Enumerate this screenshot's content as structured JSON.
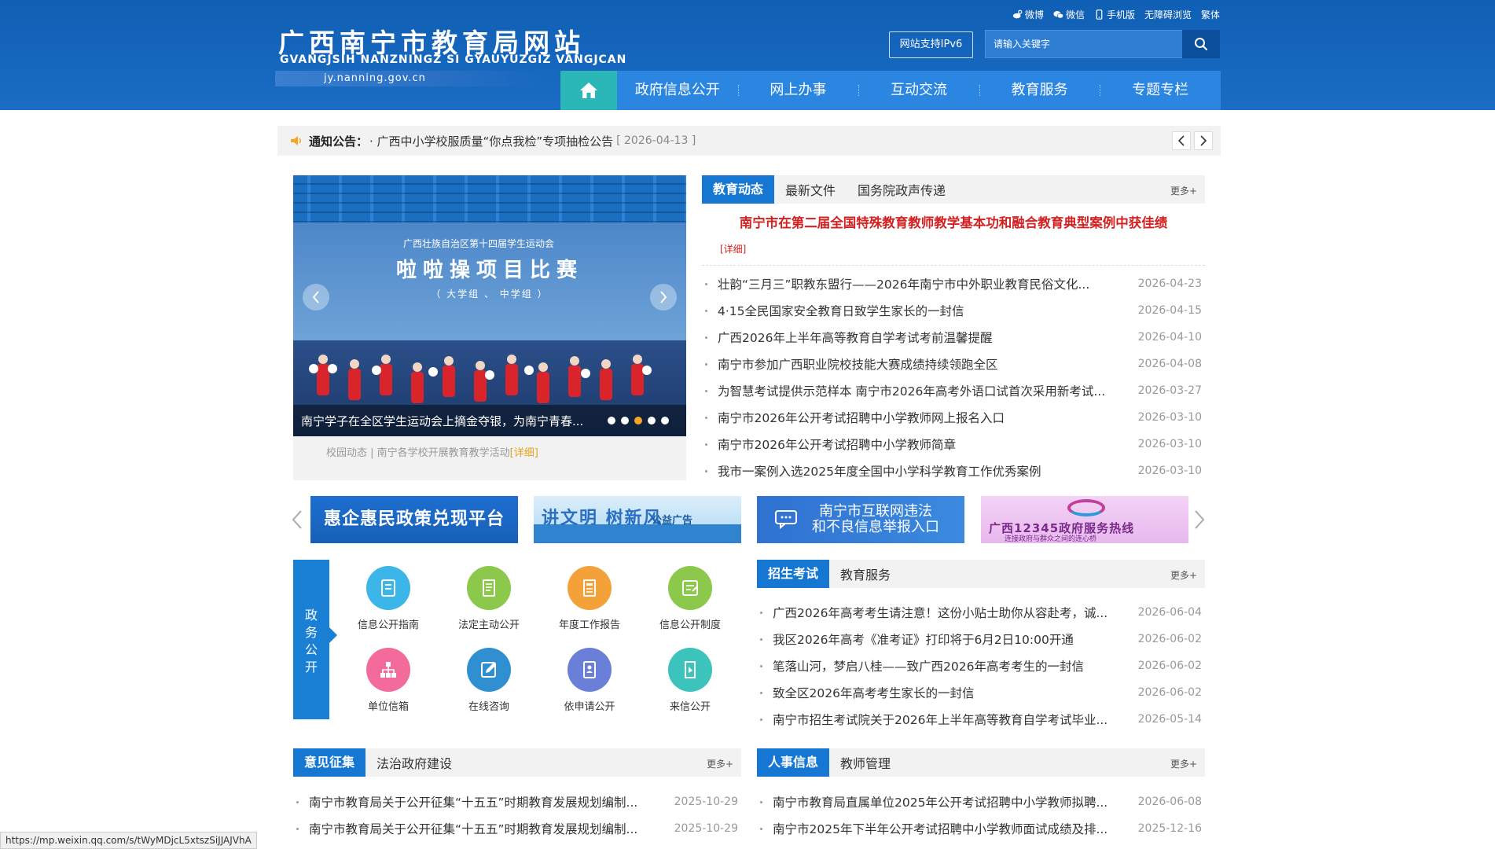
{
  "header": {
    "site_title": "广西南宁市教育局网站",
    "site_pinyin": "GVANGJSIH NANZNINGZ SI GYAUYUZGIZ VANGJCAN",
    "site_url": "jy.nanning.gov.cn",
    "top_links": {
      "weibo": "微博",
      "wechat": "微信",
      "mobile": "手机版",
      "accessibility": "无障碍浏览",
      "traditional": "繁体"
    },
    "ipv6_label": "网站支持IPv6",
    "search_placeholder": "请输入关键字"
  },
  "nav": {
    "items": [
      {
        "label": "政府信息公开"
      },
      {
        "label": "网上办事"
      },
      {
        "label": "互动交流"
      },
      {
        "label": "教育服务"
      },
      {
        "label": "专题专栏"
      }
    ]
  },
  "notice": {
    "label": "通知公告：",
    "text": "· 广西中小学校服质量“你点我检”专项抽检公告",
    "date": "[ 2026-04-13 ]"
  },
  "slider": {
    "image_logo_text": "广西壮族自治区第十四届学生运动会",
    "image_title": "啦啦操项目比赛",
    "image_subtitle": "（ 大学组 、 中学组 ）",
    "caption": "南宁学子在全区学生运动会上摘金夺银，为南宁青春...",
    "footer_text": "校园动态 | 南宁各学校开展教育教学活动",
    "footer_more": "[详细]"
  },
  "edu_news": {
    "tabs": [
      "教育动态",
      "最新文件",
      "国务院政声传递"
    ],
    "more": "更多+",
    "headline": "南宁市在第二届全国特殊教育教师教学基本功和融合教育典型案例中获佳绩",
    "headline_more": "[详细]",
    "items": [
      {
        "title": "壮韵“三月三”职教东盟行——2026年南宁市中外职业教育民俗文化...",
        "date": "2026-04-23"
      },
      {
        "title": "4·15全民国家安全教育日致学生家长的一封信",
        "date": "2026-04-15"
      },
      {
        "title": "广西2026年上半年高等教育自学考试考前温馨提醒",
        "date": "2026-04-10"
      },
      {
        "title": "南宁市参加广西职业院校技能大赛成绩持续领跑全区",
        "date": "2026-04-08"
      },
      {
        "title": "为智慧考试提供示范样本 南宁市2026年高考外语口试首次采用新考试...",
        "date": "2026-03-27"
      },
      {
        "title": "南宁市2026年公开考试招聘中小学教师网上报名入口",
        "date": "2026-03-10"
      },
      {
        "title": "南宁市2026年公开考试招聘中小学教师简章",
        "date": "2026-03-10"
      },
      {
        "title": "我市一案例入选2025年度全国中小学科学教育工作优秀案例",
        "date": "2026-03-10"
      }
    ]
  },
  "banners": {
    "b1": "惠企惠民政策兑现平台",
    "b2_main": "讲文明 树新风",
    "b2_sub": "公益广告",
    "b3_line1": "南宁市互联网违法",
    "b3_line2": "和不良信息举报入口",
    "b4_main": "广西12345政府服务热线",
    "b4_sub": "连接政府与群众之间的连心桥"
  },
  "gov_open": {
    "side_label": "政务公开",
    "items": [
      {
        "label": "信息公开指南",
        "icon": "guide-icon",
        "color": "#3cb6e8"
      },
      {
        "label": "法定主动公开",
        "icon": "document-icon",
        "color": "#8cc84b"
      },
      {
        "label": "年度工作报告",
        "icon": "report-icon",
        "color": "#f5a13a"
      },
      {
        "label": "信息公开制度",
        "icon": "rules-icon",
        "color": "#8cc84b"
      },
      {
        "label": "单位信箱",
        "icon": "org-chart-icon",
        "color": "#f26b9b"
      },
      {
        "label": "在线咨询",
        "icon": "edit-icon",
        "color": "#2f8fd0"
      },
      {
        "label": "依申请公开",
        "icon": "notebook-icon",
        "color": "#6a7fd8"
      },
      {
        "label": "来信公开",
        "icon": "letter-icon",
        "color": "#3bc3bc"
      }
    ]
  },
  "exam": {
    "tabs": [
      "招生考试",
      "教育服务"
    ],
    "more": "更多+",
    "items": [
      {
        "title": "广西2026年高考考生请注意！这份小贴士助你从容赴考，诚...",
        "date": "2026-06-04"
      },
      {
        "title": "我区2026年高考《准考证》打印将于6月2日10:00开通",
        "date": "2026-06-02"
      },
      {
        "title": "笔落山河，梦启八桂——致广西2026年高考考生的一封信",
        "date": "2026-06-02"
      },
      {
        "title": "致全区2026年高考考生家长的一封信",
        "date": "2026-06-02"
      },
      {
        "title": "南宁市招生考试院关于2026年上半年高等教育自学考试毕业...",
        "date": "2026-05-14"
      }
    ]
  },
  "opinion": {
    "tabs": [
      "意见征集",
      "法治政府建设"
    ],
    "more": "更多+",
    "items": [
      {
        "title": "南宁市教育局关于公开征集“十五五”时期教育发展规划编制...",
        "date": "2025-10-29"
      },
      {
        "title": "南宁市教育局关于公开征集“十五五”时期教育发展规划编制...",
        "date": "2025-10-29"
      }
    ]
  },
  "personnel": {
    "tabs": [
      "人事信息",
      "教师管理"
    ],
    "more": "更多+",
    "items": [
      {
        "title": "南宁市教育局直属单位2025年公开考试招聘中小学教师拟聘...",
        "date": "2026-06-08"
      },
      {
        "title": "南宁市2025年下半年公开考试招聘中小学教师面试成绩及排...",
        "date": "2025-12-16"
      }
    ]
  },
  "status_bar": {
    "url": "https://mp.weixin.qq.com/s/tWyMDjcL5xtszSiJJAJVhA"
  },
  "colors": {
    "header_blue": "#1a6cc4",
    "nav_blue": "#2b86e2",
    "home_teal": "#2bb6b8",
    "tab_blue": "#1677d2",
    "headline_red": "#d42020",
    "accent_orange": "#f5a623"
  }
}
